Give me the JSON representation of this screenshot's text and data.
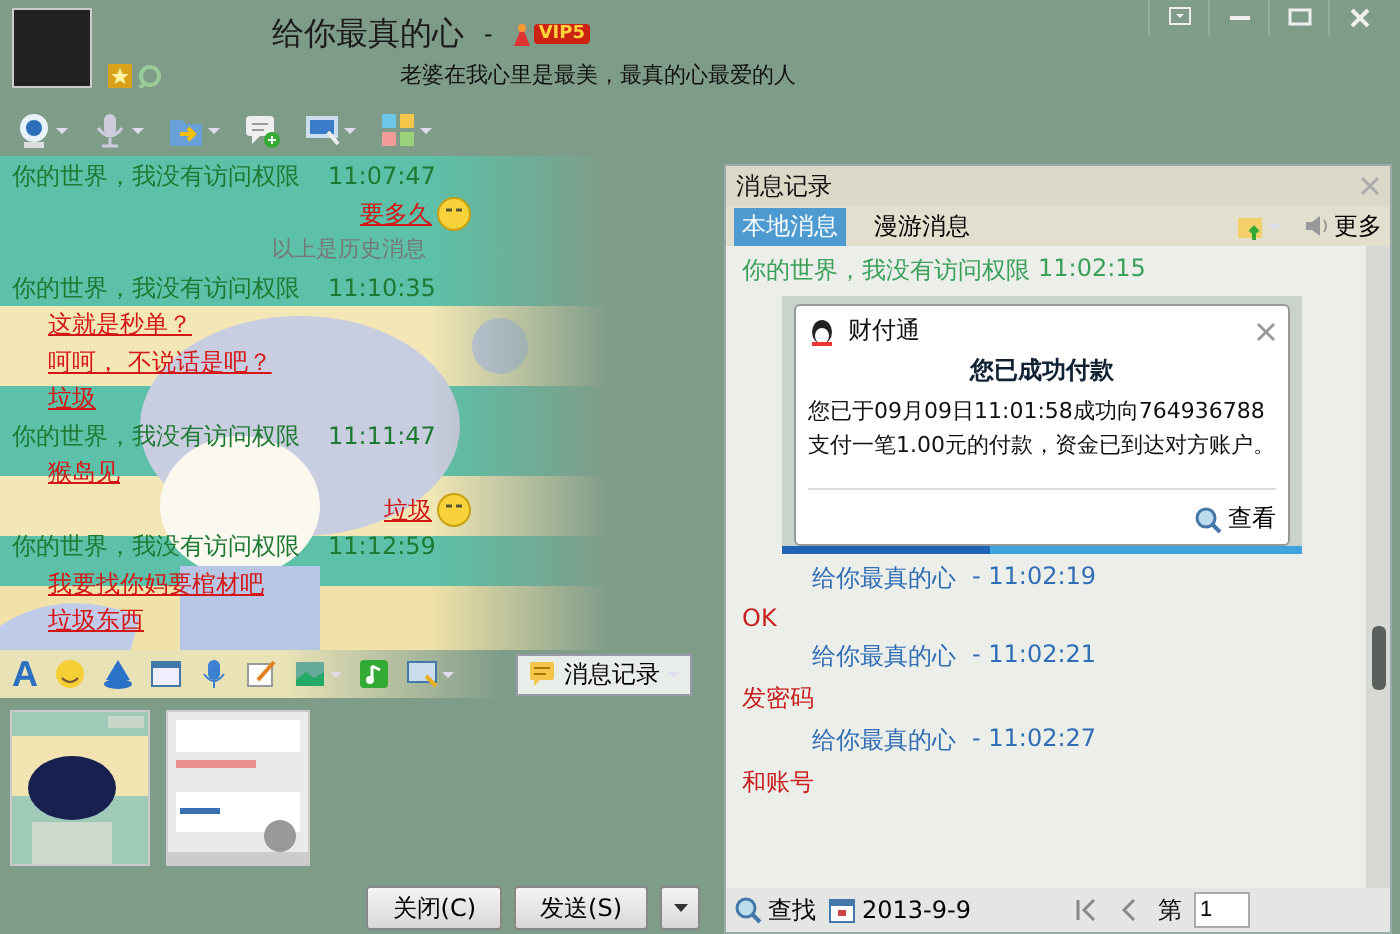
{
  "window": {
    "title": "给你最真的心",
    "separator": "-",
    "badge": "VIP5",
    "signature": "老婆在我心里是最美，最真的心最爱的人"
  },
  "chat": {
    "messages": [
      {
        "kind": "header",
        "sender": "你的世界，我没有访问权限",
        "time": "11:07:47"
      },
      {
        "kind": "sent",
        "text": "要多久"
      },
      {
        "kind": "divider",
        "text": "以上是历史消息"
      },
      {
        "kind": "header",
        "sender": "你的世界，我没有访问权限",
        "time": "11:10:35"
      },
      {
        "kind": "text",
        "text": "这就是秒单？"
      },
      {
        "kind": "text",
        "text": "呵呵， 不说话是吧？"
      },
      {
        "kind": "text",
        "text": "垃圾"
      },
      {
        "kind": "header",
        "sender": "你的世界，我没有访问权限",
        "time": "11:11:47"
      },
      {
        "kind": "text",
        "text": "猴岛见"
      },
      {
        "kind": "sent",
        "text": "垃圾"
      },
      {
        "kind": "header",
        "sender": "你的世界，我没有访问权限",
        "time": "11:12:59"
      },
      {
        "kind": "text",
        "text": "我要找你妈要棺材吧"
      },
      {
        "kind": "text",
        "text": "垃圾东西"
      }
    ]
  },
  "input_toolbar": {
    "font_button": "A",
    "history_button": "消息记录"
  },
  "buttons": [
    {
      "label": "关闭(C)"
    },
    {
      "label": "发送(S)"
    }
  ],
  "history": {
    "title": "消息记录",
    "tabs": [
      {
        "label": "本地消息",
        "selected": true
      },
      {
        "label": "漫游消息",
        "selected": false
      }
    ],
    "more": "更多",
    "messages": [
      {
        "kind": "peer_header",
        "sender": "你的世界，我没有访问权限",
        "time": "11:02:15"
      },
      {
        "kind": "card",
        "app": "财付通",
        "title": "您已成功付款",
        "body": "您已于09月09日11:01:58成功向764936788支付一笔1.00元的付款，资金已到达对方账户。",
        "action": "查看",
        "level": 0.4
      },
      {
        "kind": "self_header",
        "sender": "给你最真的心",
        "time": "- 11:02:19"
      },
      {
        "kind": "text",
        "text": "OK"
      },
      {
        "kind": "self_header",
        "sender": "给你最真的心",
        "time": "- 11:02:21"
      },
      {
        "kind": "text",
        "text": "发密码"
      },
      {
        "kind": "self_header",
        "sender": "给你最真的心",
        "time": "- 11:02:27"
      },
      {
        "kind": "text",
        "text": "和账号"
      }
    ]
  },
  "footer": {
    "find": "查找",
    "date": "2013-9-9",
    "page_label": "第",
    "page_value": "1"
  }
}
